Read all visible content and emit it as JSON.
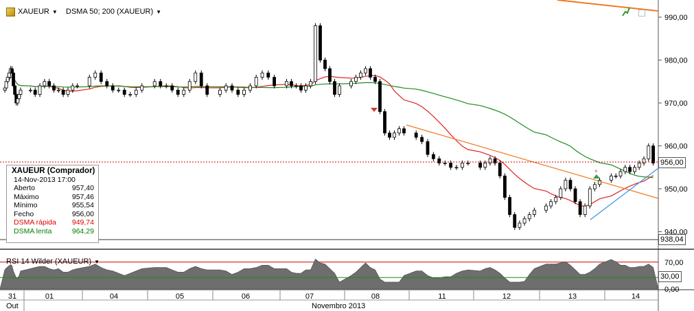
{
  "toolbar": {
    "symbol": "XAUEUR",
    "indicator": "DSMA 50; 200 (XAUEUR)"
  },
  "price_axis": {
    "ticks": [
      "990,00",
      "980,00",
      "970,00",
      "960,00",
      "950,00",
      "940,00"
    ],
    "current_price_tag": "956,00",
    "low_tag": "938,04"
  },
  "info_box": {
    "title": "XAUEUR (Comprador)",
    "datetime": "14-Nov-2013 17:00",
    "rows": [
      {
        "label": "Aberto",
        "value": "957,40",
        "color": "#000000"
      },
      {
        "label": "Máximo",
        "value": "957,46",
        "color": "#000000"
      },
      {
        "label": "Mínimo",
        "value": "955,54",
        "color": "#000000"
      },
      {
        "label": "Fecho",
        "value": "956,00",
        "color": "#000000"
      },
      {
        "label": "DSMA rápida",
        "value": "949,74",
        "color": "#dd0000"
      },
      {
        "label": "DSMA lenta",
        "value": "964,29",
        "color": "#008000"
      }
    ]
  },
  "rsi_panel": {
    "label": "RSI 14 Wilder (XAUEUR)",
    "ticks": [
      "70,00",
      "30,00",
      "0,00"
    ],
    "current_tag": "30,00",
    "upper_level": 70,
    "lower_level": 30
  },
  "time_axis": {
    "days": [
      "31",
      "01",
      "04",
      "05",
      "06",
      "07",
      "08",
      "11",
      "12",
      "13",
      "14"
    ],
    "month_left": "Out",
    "month_center": "Novembro 2013"
  },
  "colors": {
    "fast_ma": "#dd2222",
    "slow_ma": "#1e8a1e",
    "trend_orange": "#f07820",
    "trend_blue": "#3a8ee6",
    "price_line": "#cc0000",
    "rsi_fill": "#6e6e6e"
  },
  "chart_data": {
    "type": "candlestick",
    "title": "",
    "ylim": [
      938,
      992
    ],
    "days": [
      "31",
      "01",
      "04",
      "05",
      "06",
      "07",
      "08",
      "11",
      "12",
      "13",
      "14"
    ],
    "close_series_approx": [
      {
        "day": "31",
        "values": [
          973.5,
          975,
          976,
          977,
          978,
          977,
          974,
          972,
          970,
          971,
          972,
          973
        ]
      },
      {
        "day": "01",
        "values": [
          973,
          972,
          974,
          975,
          974,
          973,
          973,
          972,
          973,
          974,
          974
        ]
      },
      {
        "day": "04",
        "values": [
          976,
          977,
          975,
          974,
          973,
          973,
          972,
          972,
          973,
          974
        ]
      },
      {
        "day": "05",
        "values": [
          975,
          974,
          974,
          973,
          972,
          973,
          975,
          977,
          974,
          972
        ]
      },
      {
        "day": "06",
        "values": [
          973,
          974,
          973,
          972,
          973,
          974,
          976,
          977,
          976,
          974
        ]
      },
      {
        "day": "07",
        "values": [
          975,
          974,
          974,
          973,
          974,
          975,
          988,
          980,
          978,
          975,
          972,
          974
        ]
      },
      {
        "day": "08",
        "values": [
          975,
          976,
          977,
          978,
          976,
          975,
          968,
          963,
          962,
          963,
          964,
          963
        ]
      },
      {
        "day": "11",
        "values": [
          962,
          961,
          958,
          957,
          956,
          956,
          955,
          955,
          956,
          956
        ]
      },
      {
        "day": "12",
        "values": [
          955,
          956,
          957,
          956,
          953,
          948,
          944,
          941,
          942,
          943,
          944,
          945
        ]
      },
      {
        "day": "13",
        "values": [
          946,
          947,
          948,
          950,
          952,
          950,
          947,
          944,
          946,
          950,
          951,
          952
        ]
      },
      {
        "day": "14",
        "values": [
          953,
          953,
          954,
          955,
          954,
          955,
          956,
          957,
          960,
          956
        ]
      }
    ],
    "dsma_fast_value": 949.74,
    "dsma_slow_value": 964.29,
    "last": {
      "open": 957.4,
      "high": 957.46,
      "low": 955.54,
      "close": 956.0
    }
  }
}
